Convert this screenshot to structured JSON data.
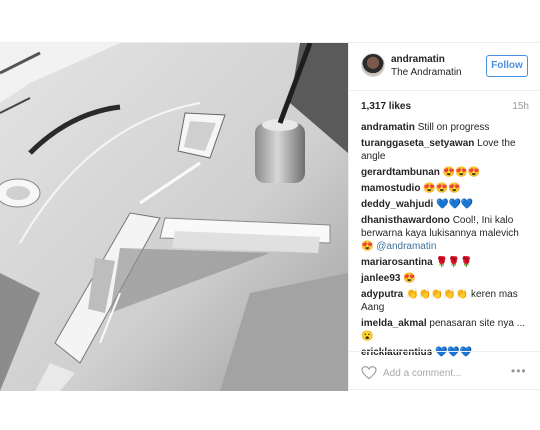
{
  "post": {
    "username": "andramatin",
    "location": "The Andramatin",
    "follow_label": "Follow",
    "likes": "1,317 likes",
    "time": "15h",
    "comments": [
      {
        "user": "andramatin",
        "text": "Still on progress",
        "mention": ""
      },
      {
        "user": "turanggaseta_setyawan",
        "text": "Love the angle",
        "mention": ""
      },
      {
        "user": "gerardtambunan",
        "text": "😍😍😍",
        "mention": ""
      },
      {
        "user": "mamostudio",
        "text": "😍😍😍",
        "mention": ""
      },
      {
        "user": "deddy_wahjudi",
        "text": "💙💙💙",
        "mention": ""
      },
      {
        "user": "dhanisthawardono",
        "text": "Cool!, Ini kalo berwarna kaya lukisannya malevich 😍",
        "mention": "@andramatin"
      },
      {
        "user": "mariarosantina",
        "text": "🌹🌹🌹",
        "mention": ""
      },
      {
        "user": "janlee93",
        "text": "😍",
        "mention": ""
      },
      {
        "user": "adyputra",
        "text": "👏👏👏👏👏 keren mas Aang",
        "mention": ""
      },
      {
        "user": "imelda_akmal",
        "text": "penasaran site nya ...😮",
        "mention": ""
      },
      {
        "user": "ericklaurentius",
        "text": "💙💙💙",
        "mention": ""
      }
    ],
    "add_comment_placeholder": "Add a comment...",
    "more_icon": "•••"
  },
  "colors": {
    "accent": "#3f729b",
    "follow": "#4a90e2"
  }
}
